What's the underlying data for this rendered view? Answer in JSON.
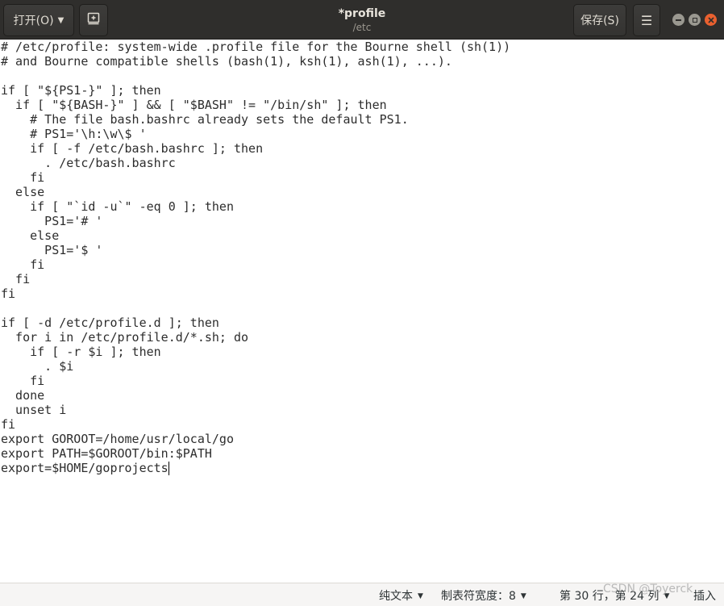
{
  "header": {
    "open_label": "打开(O)",
    "title": "*profile",
    "subtitle": "/etc",
    "save_label": "保存(S)"
  },
  "editor": {
    "lines": [
      "# /etc/profile: system-wide .profile file for the Bourne shell (sh(1))",
      "# and Bourne compatible shells (bash(1), ksh(1), ash(1), ...).",
      "",
      "if [ \"${PS1-}\" ]; then",
      "  if [ \"${BASH-}\" ] && [ \"$BASH\" != \"/bin/sh\" ]; then",
      "    # The file bash.bashrc already sets the default PS1.",
      "    # PS1='\\h:\\w\\$ '",
      "    if [ -f /etc/bash.bashrc ]; then",
      "      . /etc/bash.bashrc",
      "    fi",
      "  else",
      "    if [ \"`id -u`\" -eq 0 ]; then",
      "      PS1='# '",
      "    else",
      "      PS1='$ '",
      "    fi",
      "  fi",
      "fi",
      "",
      "if [ -d /etc/profile.d ]; then",
      "  for i in /etc/profile.d/*.sh; do",
      "    if [ -r $i ]; then",
      "      . $i",
      "    fi",
      "  done",
      "  unset i",
      "fi",
      "export GOROOT=/home/usr/local/go",
      "export PATH=$GOROOT/bin:$PATH",
      "export=$HOME/goprojects"
    ]
  },
  "statusbar": {
    "language": "纯文本",
    "tab_width": "制表符宽度：8",
    "position": "第 30 行，第 24 列",
    "mode": "插入"
  },
  "watermark": "CSDN @Toyerck",
  "colors": {
    "header_bg": "#2f2e2c",
    "close_button": "#e9602f",
    "editor_bg": "#ffffff",
    "statusbar_bg": "#f6f5f4"
  }
}
